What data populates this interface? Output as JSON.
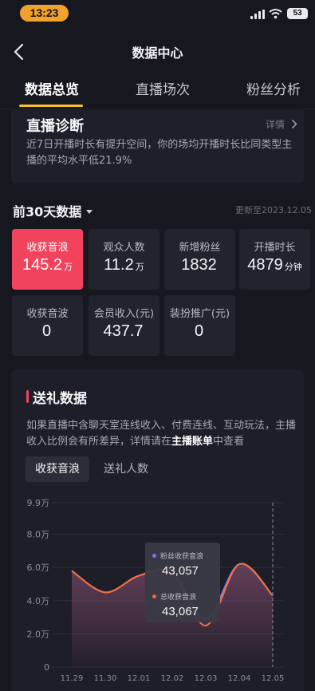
{
  "status_bar": {
    "time": "13:23",
    "battery": "53"
  },
  "nav": {
    "title": "数据中心"
  },
  "tabs": [
    {
      "label": "数据总览",
      "active": true
    },
    {
      "label": "直播场次",
      "active": false
    },
    {
      "label": "粉丝分析",
      "active": false
    }
  ],
  "diagnosis": {
    "title": "直播诊断",
    "detail_link": "详情",
    "text": "近7日开播时长有提升空间，你的场均开播时长比同类型主播的平均水平低21.9%"
  },
  "summary": {
    "period_label": "前30天数据",
    "updated": "更新至2023.12.05",
    "stats": [
      {
        "label": "收获音浪",
        "value": "145.2",
        "unit": "万",
        "active": true
      },
      {
        "label": "观众人数",
        "value": "11.2",
        "unit": "万",
        "active": false
      },
      {
        "label": "新增粉丝",
        "value": "1832",
        "unit": "",
        "active": false
      },
      {
        "label": "开播时长",
        "value": "4879",
        "unit": "分钟",
        "active": false
      },
      {
        "label": "收获音波",
        "value": "0",
        "unit": "",
        "active": false
      },
      {
        "label": "会员收入(元)",
        "value": "437.7",
        "unit": "",
        "active": false
      },
      {
        "label": "装扮推广(元)",
        "value": "0",
        "unit": "",
        "active": false
      }
    ]
  },
  "gift": {
    "title": "送礼数据",
    "desc_before": "如果直播中含聊天室连线收入、付费连线、互动玩法，主播收入比例会有所差异，详情请在",
    "desc_link": "主播账单",
    "desc_after": "中查看",
    "segments": [
      {
        "label": "收获音浪",
        "active": true
      },
      {
        "label": "送礼人数",
        "active": false
      }
    ]
  },
  "tooltip": {
    "rows": [
      {
        "label": "粉丝收获音浪",
        "value": "43,057",
        "color": "#7b7bf2"
      },
      {
        "label": "总收获音浪",
        "value": "43,067",
        "color": "#f5703a"
      }
    ]
  },
  "colors": {
    "accent": "#f2435e",
    "tab_underline": "#f3c131",
    "series_fans": "#7b7bf2",
    "series_total": "#f5703a"
  },
  "chart_data": {
    "type": "area",
    "x": [
      "11.29",
      "11.30",
      "12.01",
      "12.02",
      "12.03",
      "12.04",
      "12.05"
    ],
    "y_ticks": [
      "0",
      "2.0万",
      "4.0万",
      "6.0万",
      "8.0万",
      "9.9万"
    ],
    "ylim": [
      0,
      99000
    ],
    "series": [
      {
        "name": "粉丝收获音浪",
        "values": [
          58000,
          45000,
          55000,
          57000,
          29000,
          62000,
          43057
        ]
      },
      {
        "name": "总收获音浪",
        "values": [
          58000,
          45000,
          55000,
          57000,
          25000,
          62000,
          43067
        ]
      }
    ],
    "grid": true,
    "highlighted_index": 6
  }
}
